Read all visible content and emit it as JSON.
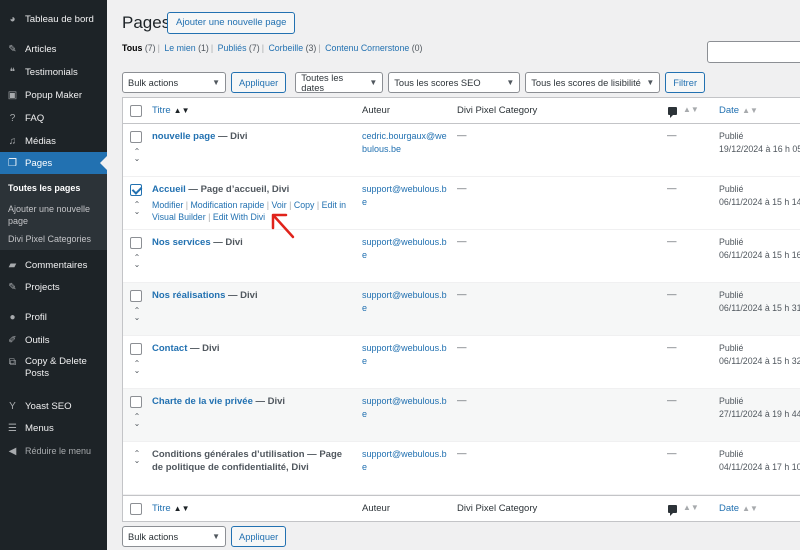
{
  "sidebar": {
    "items": [
      {
        "label": "Tableau de bord",
        "icon": "dashboard-icon"
      },
      {
        "label": "Articles",
        "icon": "pin-icon"
      },
      {
        "label": "Testimonials",
        "icon": "quote-icon"
      },
      {
        "label": "Popup Maker",
        "icon": "popup-icon"
      },
      {
        "label": "FAQ",
        "icon": "question-icon"
      },
      {
        "label": "Médias",
        "icon": "media-icon"
      },
      {
        "label": "Pages",
        "icon": "pages-icon"
      },
      {
        "label": "Commentaires",
        "icon": "comment-icon"
      },
      {
        "label": "Projects",
        "icon": "pin-icon"
      },
      {
        "label": "Profil",
        "icon": "user-icon"
      },
      {
        "label": "Outils",
        "icon": "wrench-icon"
      },
      {
        "label": "Copy & Delete Posts",
        "icon": "copy-icon"
      },
      {
        "label": "Yoast SEO",
        "icon": "yoast-icon"
      },
      {
        "label": "Menus",
        "icon": "menu-icon"
      }
    ],
    "submenu": [
      "Toutes les pages",
      "Ajouter une nouvelle page",
      "Divi Pixel Categories"
    ],
    "collapse_label": "Réduire le menu"
  },
  "header": {
    "title": "Pages",
    "add_new_label": "Ajouter une nouvelle page"
  },
  "filters": [
    {
      "label": "Tous",
      "count": "(7)"
    },
    {
      "label": "Le mien",
      "count": "(1)"
    },
    {
      "label": "Publiés",
      "count": "(7)"
    },
    {
      "label": "Corbeille",
      "count": "(3)"
    },
    {
      "label": "Contenu Cornerstone",
      "count": "(0)"
    }
  ],
  "tablenav": {
    "bulk_actions": "Bulk actions",
    "apply": "Appliquer",
    "dates": "Toutes les dates",
    "seo": "Tous les scores SEO",
    "readability": "Tous les scores de lisibilité",
    "filter": "Filtrer"
  },
  "table": {
    "columns": {
      "title": "Titre",
      "author": "Auteur",
      "category": "Divi Pixel Category",
      "date": "Date"
    },
    "row_actions": {
      "edit": "Modifier",
      "quick_edit": "Modification rapide",
      "view": "Voir",
      "copy": "Copy",
      "edit_visual": "Edit in Visual Builder",
      "edit_divi": "Edit With Divi"
    },
    "rows": [
      {
        "title": "nouvelle page",
        "suffix": " — Divi",
        "author": "cedric.bourgaux@webulous.be",
        "category": "—",
        "comments": "—",
        "status": "Publié",
        "date": "19/12/2024 à 16 h 05"
      },
      {
        "title": "Accueil",
        "suffix": " — Page d’accueil, Divi",
        "author": "support@webulous.be",
        "category": "—",
        "comments": "—",
        "status": "Publié",
        "date": "06/11/2024 à 15 h 14"
      },
      {
        "title": "Nos services",
        "suffix": " — Divi",
        "author": "support@webulous.be",
        "category": "—",
        "comments": "—",
        "status": "Publié",
        "date": "06/11/2024 à 15 h 16"
      },
      {
        "title": "Nos réalisations",
        "suffix": " — Divi",
        "author": "support@webulous.be",
        "category": "—",
        "comments": "—",
        "status": "Publié",
        "date": "06/11/2024 à 15 h 31"
      },
      {
        "title": "Contact",
        "suffix": " — Divi",
        "author": "support@webulous.be",
        "category": "—",
        "comments": "—",
        "status": "Publié",
        "date": "06/11/2024 à 15 h 32"
      },
      {
        "title": "Charte de la vie privée",
        "suffix": " — Divi",
        "author": "support@webulous.be",
        "category": "—",
        "comments": "—",
        "status": "Publié",
        "date": "27/11/2024 à 19 h 44"
      },
      {
        "title": "",
        "suffix": "Conditions générales d’utilisation — Page de politique de confidentialité, Divi",
        "author": "support@webulous.be",
        "category": "—",
        "comments": "—",
        "status": "Publié",
        "date": "04/11/2024 à 17 h 10"
      }
    ]
  },
  "colors": {
    "accent": "#2271b1",
    "sidebar_bg": "#1d2327",
    "annotation": "#e0231b"
  }
}
